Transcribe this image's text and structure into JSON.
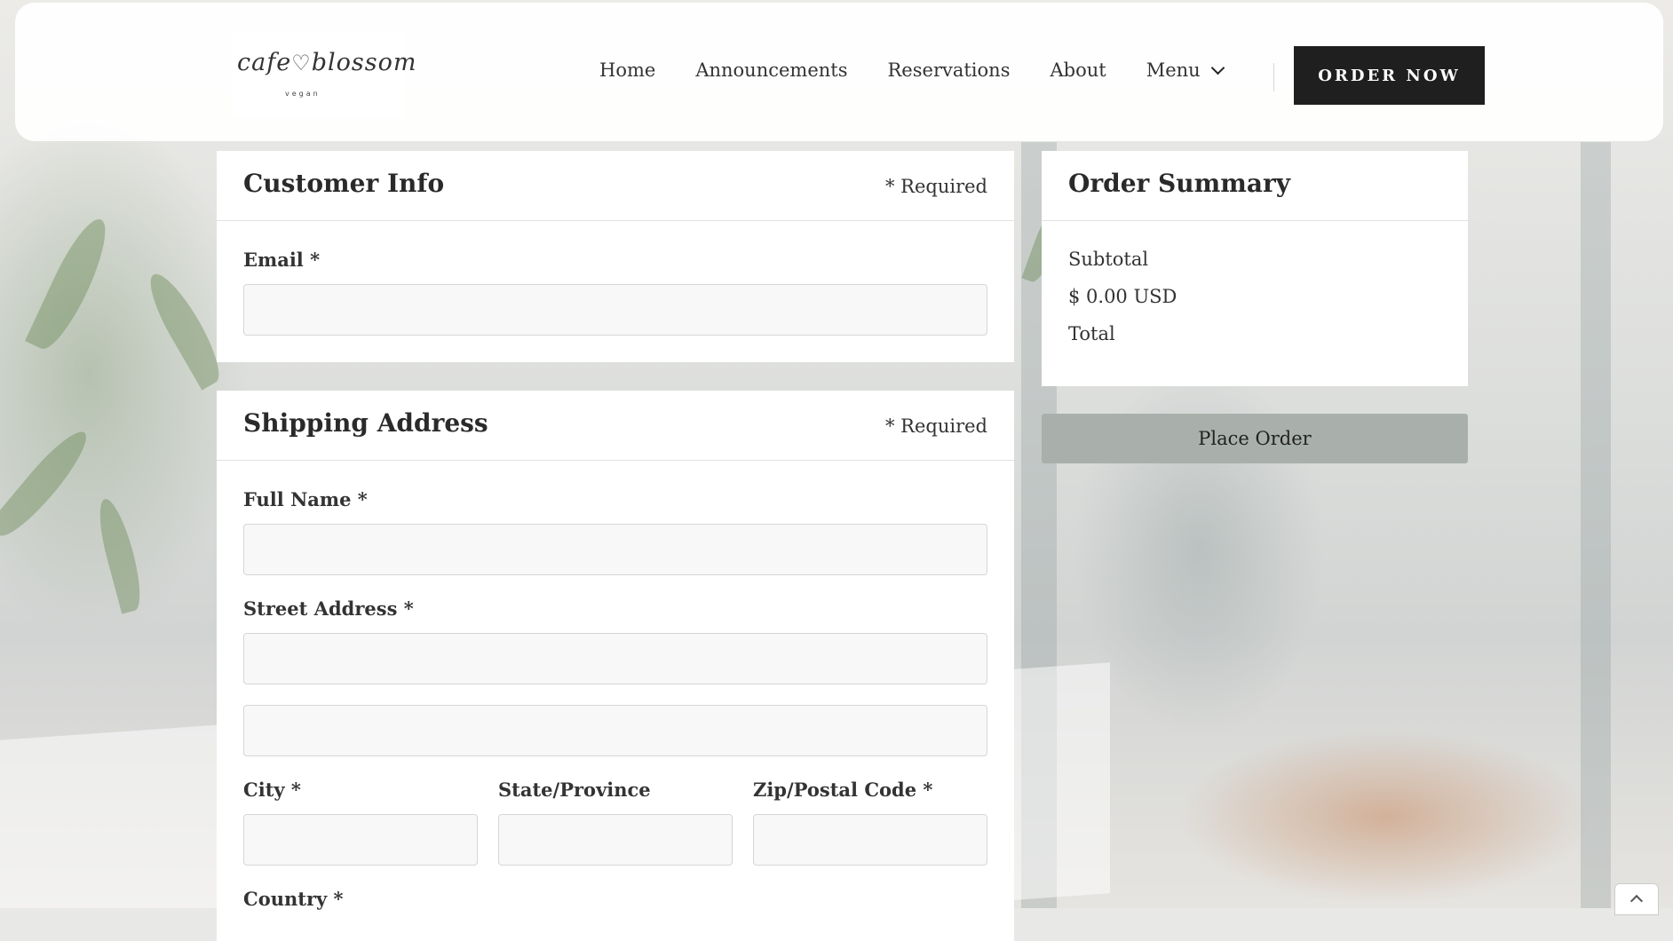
{
  "brand": {
    "logo_main": "cafe",
    "logo_heart": "♡",
    "logo_main2": "blossom",
    "logo_sub": "vegan"
  },
  "nav": {
    "items": [
      "Home",
      "Announcements",
      "Reservations",
      "About"
    ],
    "menu_label": "Menu",
    "cta": "ORDER NOW"
  },
  "customer_info": {
    "title": "Customer Info",
    "required_note": "* Required",
    "email_label": "Email *",
    "email_value": ""
  },
  "shipping": {
    "title": "Shipping Address",
    "required_note": "* Required",
    "full_name_label": "Full Name *",
    "street_label": "Street Address *",
    "city_label": "City *",
    "state_label": "State/Province",
    "zip_label": "Zip/Postal Code *",
    "country_label": "Country *"
  },
  "order_summary": {
    "title": "Order Summary",
    "subtotal_label": "Subtotal",
    "subtotal_value": "$ 0.00 USD",
    "total_label": "Total",
    "place_order": "Place Order"
  },
  "icons": {
    "menu_dropdown": "chevron-down-icon",
    "scroll_top": "chevron-up-icon"
  }
}
